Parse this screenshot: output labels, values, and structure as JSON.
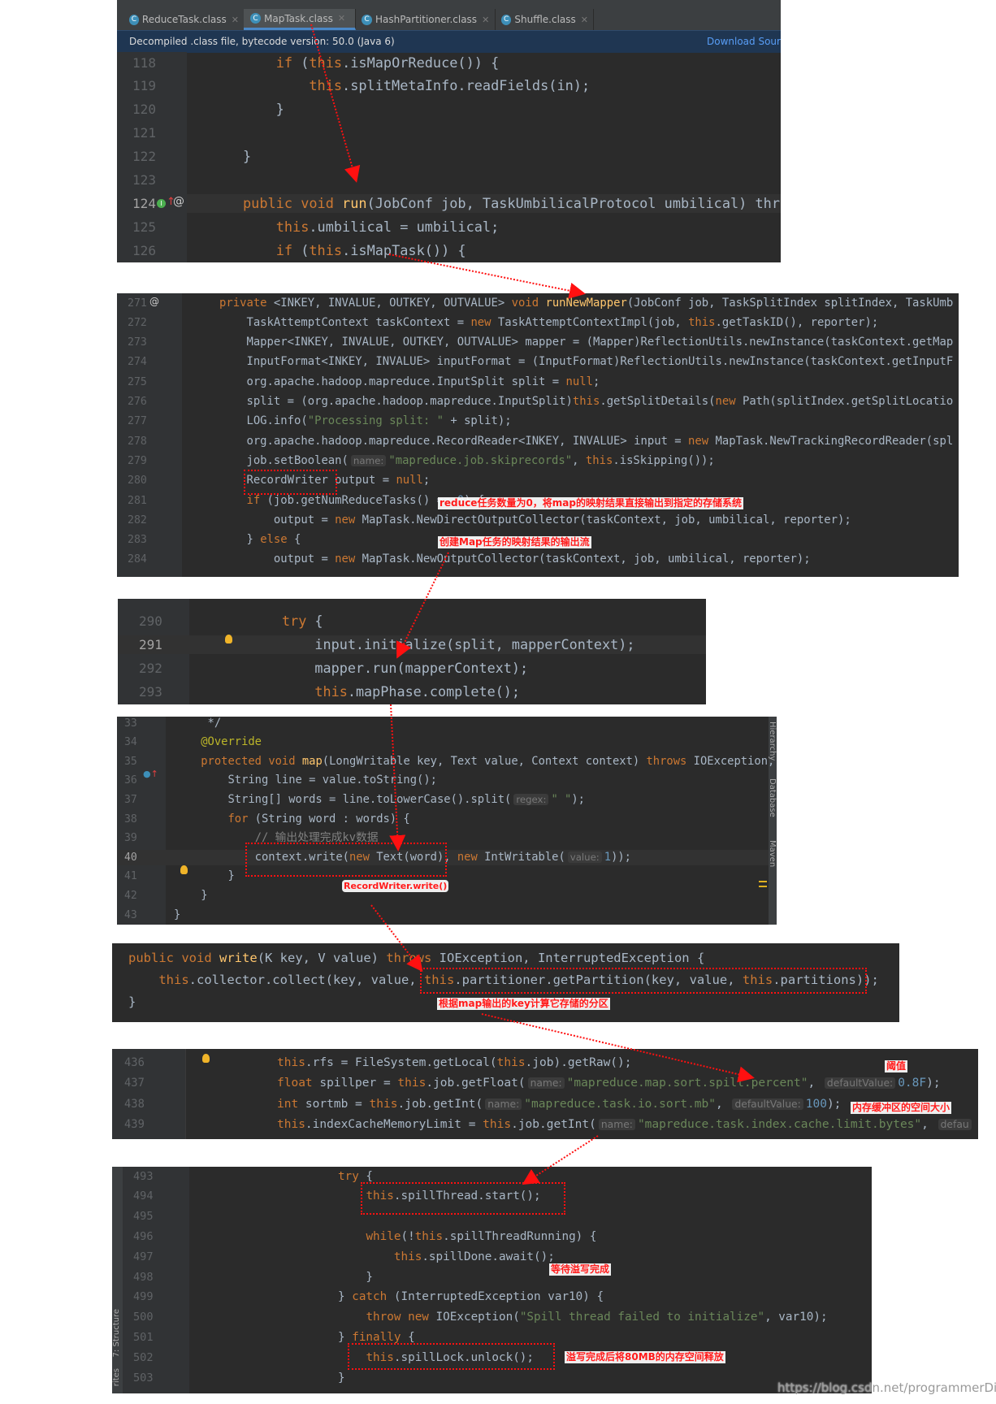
{
  "editor_tabs": [
    {
      "label": "ReduceTask.class",
      "active": false,
      "icon": "class-icon"
    },
    {
      "label": "MapTask.class",
      "active": true,
      "icon": "class-icon"
    },
    {
      "label": "HashPartitioner.class",
      "active": false,
      "icon": "class-icon"
    },
    {
      "label": "Shuffle.class",
      "active": false,
      "icon": "class-icon"
    }
  ],
  "info_bar": {
    "text": "Decompiled .class file, bytecode version: 50.0 (Java 6)",
    "link": "Download Sour"
  },
  "side_tools": {
    "right": [
      "Hierarchy",
      "Database",
      "Maven"
    ],
    "left": [
      "7: Structure",
      "rites"
    ]
  },
  "colors": {
    "background": "#2b2b2b",
    "keyword": "#cc7832",
    "string": "#6a8759",
    "number": "#6897bb",
    "text": "#a9b7c6",
    "annotation_red": "#ff1a1a"
  },
  "panels": [
    {
      "id": "p1",
      "current_line": "124",
      "lines": [
        {
          "n": "118",
          "code": [
            "    if (this.isMapOrReduce()) {"
          ]
        },
        {
          "n": "119",
          "code": [
            "        this.splitMetaInfo.readFields(in);"
          ]
        },
        {
          "n": "120",
          "code": [
            "    }"
          ]
        },
        {
          "n": "121",
          "code": [
            ""
          ]
        },
        {
          "n": "122",
          "code": [
            "}"
          ]
        },
        {
          "n": "123",
          "code": [
            ""
          ]
        },
        {
          "n": "124",
          "code": [
            "public void ",
            {
              "t": "run",
              "k": "decl"
            },
            "(JobConf job, TaskUmbilicalProtocol umbilical) thr"
          ]
        },
        {
          "n": "125",
          "code": [
            "    this.umbilical = umbilical;"
          ]
        },
        {
          "n": "126",
          "code": [
            "    if (this.isMapTask()) {"
          ]
        }
      ]
    },
    {
      "id": "p2",
      "current_line": "",
      "lines": [
        {
          "n": "271",
          "code": [
            "private <INKEY, INVALUE, OUTKEY, OUTVALUE> void ",
            {
              "t": "runNewMapper",
              "k": "decl"
            },
            "(JobConf job, TaskSplitIndex splitIndex, TaskUmb"
          ]
        },
        {
          "n": "272",
          "code": [
            "    TaskAttemptContext taskContext = new TaskAttemptContextImpl(job, this.getTaskID(), reporter);"
          ]
        },
        {
          "n": "273",
          "code": [
            "    Mapper<INKEY, INVALUE, OUTKEY, OUTVALUE> mapper = (Mapper)ReflectionUtils.newInstance(taskContext.getMap"
          ]
        },
        {
          "n": "274",
          "code": [
            "    InputFormat<INKEY, INVALUE> inputFormat = (InputFormat)ReflectionUtils.newInstance(taskContext.getInputF"
          ]
        },
        {
          "n": "275",
          "code": [
            "    org.apache.hadoop.mapreduce.InputSplit split = null;"
          ]
        },
        {
          "n": "276",
          "code": [
            "    split = (org.apache.hadoop.mapreduce.InputSplit)this.getSplitDetails(new Path(splitIndex.getSplitLocatio"
          ]
        },
        {
          "n": "277",
          "code": [
            "    LOG.info(\"Processing split: \" + split);"
          ]
        },
        {
          "n": "278",
          "code": [
            "    org.apache.hadoop.mapreduce.RecordReader<INKEY, INVALUE> input = new MapTask.NewTrackingRecordReader(spl"
          ]
        },
        {
          "n": "279",
          "code": [
            "    job.setBoolean(",
            {
              "t": "name:",
              "k": "hint"
            },
            "\"mapreduce.job.skiprecords\", this.isSkipping());"
          ]
        },
        {
          "n": "280",
          "code": [
            "    RecordWriter output = null;"
          ]
        },
        {
          "n": "281",
          "code": [
            "    if (job.getNumReduceTasks() == 0) {"
          ]
        },
        {
          "n": "282",
          "code": [
            "        output = new MapTask.NewDirectOutputCollector(taskContext, job, umbilical, reporter);"
          ]
        },
        {
          "n": "283",
          "code": [
            "    } else {"
          ]
        },
        {
          "n": "284",
          "code": [
            "        output = new MapTask.NewOutputCollector(taskContext, job, umbilical, reporter);"
          ]
        }
      ]
    },
    {
      "id": "p3",
      "current_line": "291",
      "lines": [
        {
          "n": "290",
          "code": [
            "try {"
          ]
        },
        {
          "n": "291",
          "code": [
            "    input.initialize(split, mapperContext);"
          ]
        },
        {
          "n": "292",
          "code": [
            "    mapper.run(mapperContext);"
          ]
        },
        {
          "n": "293",
          "code": [
            "    this.mapPhase.complete();"
          ]
        }
      ]
    },
    {
      "id": "p4",
      "current_line": "40",
      "lines": [
        {
          "n": "33",
          "code": [
            "     */"
          ]
        },
        {
          "n": "34",
          "code": [
            "    @Override"
          ]
        },
        {
          "n": "35",
          "code": [
            "    protected void ",
            {
              "t": "map",
              "k": "decl"
            },
            "(LongWritable key, Text value, Context context) throws IOException,"
          ]
        },
        {
          "n": "36",
          "code": [
            "        String line = value.toString();"
          ]
        },
        {
          "n": "37",
          "code": [
            "        String[] words = line.toLowerCase().split(",
            {
              "t": "regex:",
              "k": "hint"
            },
            "\" \");"
          ]
        },
        {
          "n": "38",
          "code": [
            "        for (String word : words) {"
          ]
        },
        {
          "n": "39",
          "code": [
            "            // 输出处理完成kv数据"
          ]
        },
        {
          "n": "40",
          "code": [
            "            context.write(new Text(word), new IntWritable(",
            {
              "t": "value:",
              "k": "hint"
            },
            "1));"
          ]
        },
        {
          "n": "41",
          "code": [
            "        }"
          ]
        },
        {
          "n": "42",
          "code": [
            "    }"
          ]
        },
        {
          "n": "43",
          "code": [
            "}"
          ]
        }
      ]
    },
    {
      "id": "p5",
      "current_line": "",
      "lines": [
        {
          "n": "",
          "code": [
            "public void ",
            {
              "t": "write",
              "k": "decl"
            },
            "(K key, V value) throws IOException, InterruptedException {"
          ]
        },
        {
          "n": "",
          "code": [
            "    this.collector.collect(key, value, this.partitioner.getPartition(key, value, this.partitions));"
          ]
        },
        {
          "n": "",
          "code": [
            "}"
          ]
        }
      ]
    },
    {
      "id": "p6",
      "current_line": "",
      "lines": [
        {
          "n": "436",
          "code": [
            "this.rfs = FileSystem.getLocal(this.job).getRaw();"
          ]
        },
        {
          "n": "437",
          "code": [
            "float spillper = this.job.getFloat(",
            {
              "t": "name:",
              "k": "hint"
            },
            "\"mapreduce.map.sort.spill.percent\", ",
            {
              "t": "defaultValue:",
              "k": "hint"
            },
            "0.8F);"
          ]
        },
        {
          "n": "438",
          "code": [
            "int sortmb = this.job.getInt(",
            {
              "t": "name:",
              "k": "hint"
            },
            "\"mapreduce.task.io.sort.mb\", ",
            {
              "t": "defaultValue:",
              "k": "hint"
            },
            "100);"
          ]
        },
        {
          "n": "439",
          "code": [
            "this.indexCacheMemoryLimit = this.job.getInt(",
            {
              "t": "name:",
              "k": "hint"
            },
            "\"mapreduce.task.index.cache.limit.bytes\", ",
            {
              "t": "defau",
              "k": "hint"
            }
          ]
        }
      ]
    },
    {
      "id": "p7",
      "current_line": "",
      "lines": [
        {
          "n": "493",
          "code": [
            "try {"
          ]
        },
        {
          "n": "494",
          "code": [
            "    this.spillThread.start();"
          ]
        },
        {
          "n": "495",
          "code": [
            ""
          ]
        },
        {
          "n": "496",
          "code": [
            "    while(!this.spillThreadRunning) {"
          ]
        },
        {
          "n": "497",
          "code": [
            "        this.spillDone.await();"
          ]
        },
        {
          "n": "498",
          "code": [
            "    }"
          ]
        },
        {
          "n": "499",
          "code": [
            "} catch (InterruptedException var10) {"
          ]
        },
        {
          "n": "500",
          "code": [
            "    throw new IOException(\"Spill thread failed to initialize\", var10);"
          ]
        },
        {
          "n": "501",
          "code": [
            "} finally {"
          ]
        },
        {
          "n": "502",
          "code": [
            "    this.spillLock.unlock();"
          ]
        },
        {
          "n": "503",
          "code": [
            "}"
          ]
        }
      ]
    }
  ],
  "annotations": {
    "reduce_zero": "reduce任务数量为0，将map的映射结果直接输出到指定的存储系统",
    "create_output": "创建Map任务的映射结果的输出流",
    "record_writer": "RecordWriter.write()",
    "partition": "根据map输出的key计算它存储的分区",
    "threshold": "阈值",
    "buffer_size": "内存缓冲区的空间大小",
    "wait_spill": "等待溢写完成",
    "release_memory": "溢写完成后将80MB的内存空间释放"
  },
  "watermark": "https://blog.csdn.net/programmerDingl"
}
